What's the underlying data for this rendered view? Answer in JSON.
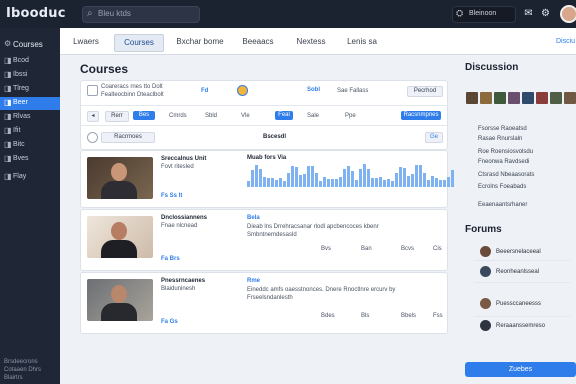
{
  "app": {
    "logo": "Ibooduc",
    "search_placeholder": "Bleu ktds",
    "user_label": "Bleinoon"
  },
  "sidebar": {
    "header": "Courses",
    "items": [
      "Bcod",
      "Ibssi",
      "Tlreg",
      "Beer",
      "Rlvas",
      "Ifit",
      "Bitc",
      "Bves",
      "Flay"
    ],
    "active_index": 3,
    "footer": [
      "Brsdeecrons",
      "Cotaaen Dhrs",
      "Blairtrs"
    ]
  },
  "tabs": {
    "items": [
      "Lwaers",
      "Courses",
      "Bxchar bome",
      "Beeaacs",
      "Nextess",
      "Lenis sa"
    ],
    "active_index": 1,
    "right_link": "Disciu"
  },
  "sections": {
    "courses": "Courses",
    "discussion": "Discussion",
    "forums": "Forums"
  },
  "filter_card": {
    "line1": "Coareracs rnes tto Dolt",
    "line2": "Fealteocbinn Dteaclbolt",
    "code": "Fd",
    "sort": "Sobl",
    "tag": "Sae Fallass",
    "action": "Pecrhod",
    "chips": [
      "Rerr",
      "Bes",
      "Cmrds",
      "Sbld",
      "Vle",
      "Feal",
      "Sale",
      "Ppe"
    ],
    "right_btn": "Racsnmpnes",
    "select": "Racrrnoes",
    "center": "Bscesdl",
    "badge": "Ge"
  },
  "courses": [
    {
      "title": "Sreccalnus Unit",
      "sub": "Fovt ritesled",
      "meta": "Fs Ss lt",
      "header": "Muab fors Via",
      "lines": [
        "",
        ""
      ],
      "stats": []
    },
    {
      "title": "Dnclossiannens",
      "sub": "Fnae nlcnead",
      "meta": "Fa Brs",
      "header": "Bela",
      "lines": [
        "Dieab lns Drrehracsanar rlodl apcbencoces kbenr",
        "Smbntnemdesasld"
      ],
      "stats": [
        "Bvs",
        "Ban",
        "Bcvs",
        "Cis"
      ]
    },
    {
      "title": "Pnessrncaenes",
      "sub": "Blaiduninesh",
      "meta": "Fa Gs",
      "header": "Rme",
      "lines": [
        "Eineddc amfs oaesstnonces. Dnere Rnoctlnre ercurv by",
        "Frseelsndanlesth"
      ],
      "stats": [
        "Bdes",
        "Bls",
        "Bbels",
        "Fss"
      ]
    }
  ],
  "discussion": {
    "rows": [
      "Fsorsse Raoeatsd",
      "Rasae Rnurslaln",
      "Roe Roensiosvolsdu",
      "Fneonwa Ravdsedi",
      "Ctsrasd Nbeaasorats",
      "Ecrolns Foeabads",
      "Eeaenaantsrhaner"
    ]
  },
  "forums": {
    "rows": [
      "Beeersnelaceeal",
      "Reonheanlsseal",
      "Puessccaneesss",
      "Reraaanssemreso"
    ],
    "button": "Zuebes"
  },
  "colors": {
    "accent": "#2f7dea",
    "sidebar": "#1f2737",
    "topbar": "#1b2230"
  }
}
